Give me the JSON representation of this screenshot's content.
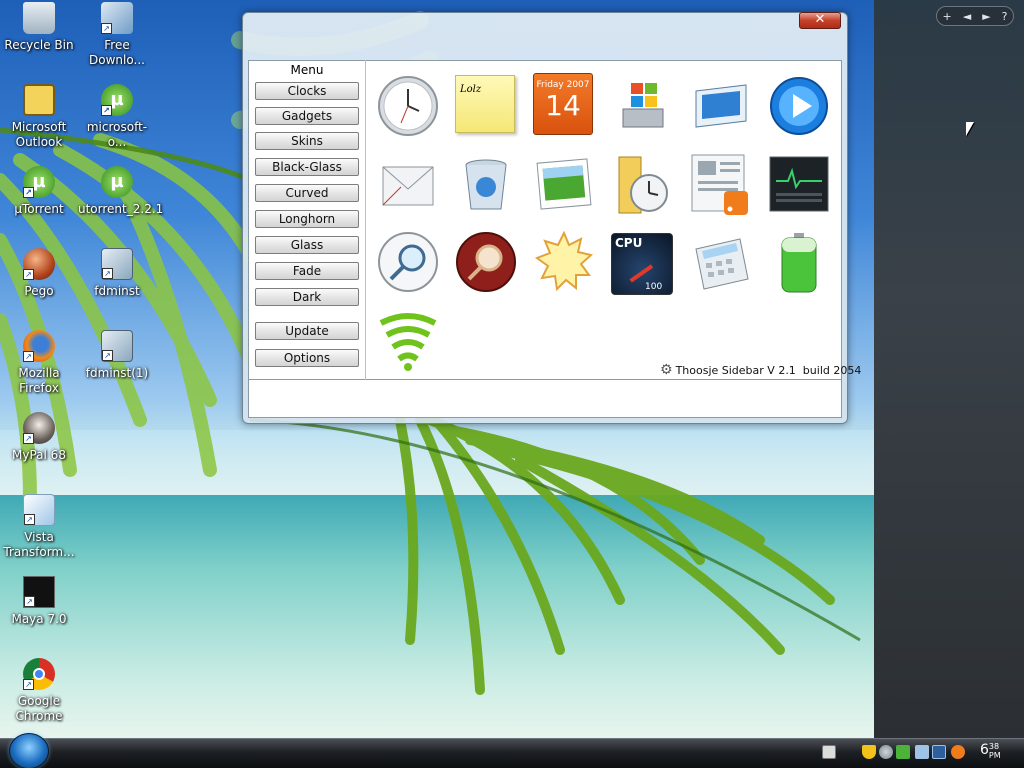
{
  "desktop": {
    "icons": [
      {
        "label": "Recycle Bin",
        "icon": "recycle-bin-icon"
      },
      {
        "label": "Free Downlo...",
        "icon": "free-download-icon"
      },
      {
        "label": "Microsoft Outlook",
        "icon": "outlook-icon"
      },
      {
        "label": "microsoft-o...",
        "icon": "utorrent-icon"
      },
      {
        "label": "µTorrent",
        "icon": "utorrent-icon"
      },
      {
        "label": "utorrent_2.2.1",
        "icon": "utorrent-icon"
      },
      {
        "label": "Pego",
        "icon": "pego-icon"
      },
      {
        "label": "fdminst",
        "icon": "fdminst-icon"
      },
      {
        "label": "Mozilla Firefox",
        "icon": "firefox-icon"
      },
      {
        "label": "fdminst(1)",
        "icon": "fdminst-icon"
      },
      {
        "label": "MyPal 68",
        "icon": "mypal-icon"
      },
      {
        "label": "Vista Transform...",
        "icon": "vista-transform-icon"
      },
      {
        "label": "Maya 7.0",
        "icon": "maya-icon"
      },
      {
        "label": "Google Chrome",
        "icon": "chrome-icon"
      }
    ]
  },
  "sidebar_controls": {
    "add": "+",
    "prev": "◄",
    "next": "►",
    "help": "?"
  },
  "window": {
    "close_label": "✕",
    "menu": {
      "title": "Menu",
      "items": [
        "Clocks",
        "Gadgets",
        "Skins",
        "Black-Glass",
        "Curved",
        "Longhorn",
        "Glass",
        "Fade",
        "Dark"
      ],
      "update": "Update",
      "options": "Options"
    },
    "gadgets": {
      "note_text": "Lolz",
      "calendar_weekday": "Friday 2007",
      "calendar_day": "14",
      "cpu_label": "CPU",
      "cpu_value": "100"
    },
    "credit": "Thoosje Sidebar V 2.1  build 2054"
  },
  "taskbar": {
    "clock_hour": "6",
    "clock_minute": "38",
    "clock_ampm": "PM"
  },
  "colors": {
    "accent": "#1c6fc2",
    "close_red": "#c6412a",
    "taskbar": "#1d2024"
  }
}
